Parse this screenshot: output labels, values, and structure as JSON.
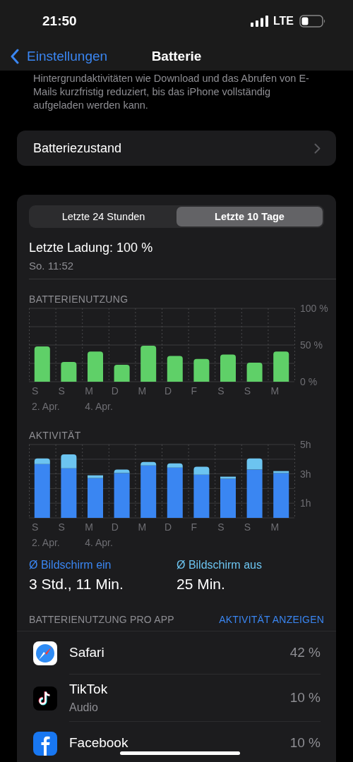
{
  "status_bar": {
    "time": "21:50",
    "network": "LTE"
  },
  "nav": {
    "back": "Einstellungen",
    "title": "Batterie"
  },
  "intro_text": "Hintergrundaktivitäten wie Download und das Abrufen von E-Mails kurzfristig reduziert, bis das iPhone vollständig aufgeladen werden kann.",
  "health_row": {
    "label": "Batteriezustand"
  },
  "range_tabs": [
    {
      "label": "Letzte 24 Stunden",
      "selected": false
    },
    {
      "label": "Letzte 10 Tage",
      "selected": true
    }
  ],
  "last_charge": {
    "title": "Letzte Ladung: 100 %",
    "time": "So. 11:52"
  },
  "usage_chart": {
    "chart_data": {
      "type": "bar",
      "title": "BATTERIENUTZUNG",
      "categories": [
        "S",
        "S",
        "M",
        "D",
        "M",
        "D",
        "F",
        "S",
        "S",
        "M"
      ],
      "ylim": [
        0,
        100
      ],
      "yticks": [
        {
          "value": 0,
          "label": "0 %"
        },
        {
          "value": 50,
          "label": "50 %"
        },
        {
          "value": 100,
          "label": "100 %"
        }
      ],
      "values": [
        48,
        27,
        41,
        23,
        49,
        35,
        31,
        37,
        26,
        41
      ]
    },
    "date_labels": [
      "2. Apr.",
      "4. Apr."
    ]
  },
  "activity_chart": {
    "chart_data": {
      "type": "bar",
      "title": "AKTIVITÄT",
      "categories": [
        "S",
        "S",
        "M",
        "D",
        "M",
        "D",
        "F",
        "S",
        "S",
        "M"
      ],
      "stacked": true,
      "ylim": [
        0,
        5
      ],
      "yticks": [
        {
          "value": 1,
          "label": "1h"
        },
        {
          "value": 3,
          "label": "3h"
        },
        {
          "value": 5,
          "label": "5h"
        }
      ],
      "series": [
        {
          "name": "Ø Bildschirm ein",
          "color": "#3a86f2",
          "values": [
            3.67,
            3.38,
            2.71,
            3.05,
            3.57,
            3.43,
            2.95,
            2.67,
            3.29,
            3.05
          ]
        },
        {
          "name": "Ø Bildschirm aus",
          "color": "#6cc4f0",
          "values": [
            0.38,
            0.95,
            0.19,
            0.24,
            0.24,
            0.28,
            0.53,
            0.14,
            0.76,
            0.14
          ]
        }
      ]
    },
    "date_labels": [
      "2. Apr.",
      "4. Apr."
    ]
  },
  "averages": [
    {
      "value": "3 Std., 11 Min."
    },
    {
      "value": "25 Min."
    }
  ],
  "app_usage": {
    "header": "BATTERIENUTZUNG PRO APP",
    "action": "AKTIVITÄT ANZEIGEN",
    "apps": [
      {
        "kind": "safari",
        "name": "Safari",
        "percent": "42 %"
      },
      {
        "kind": "tiktok",
        "name": "TikTok",
        "detail": "Audio",
        "percent": "10 %"
      },
      {
        "kind": "facebook",
        "name": "Facebook",
        "percent": "10 %"
      }
    ]
  }
}
